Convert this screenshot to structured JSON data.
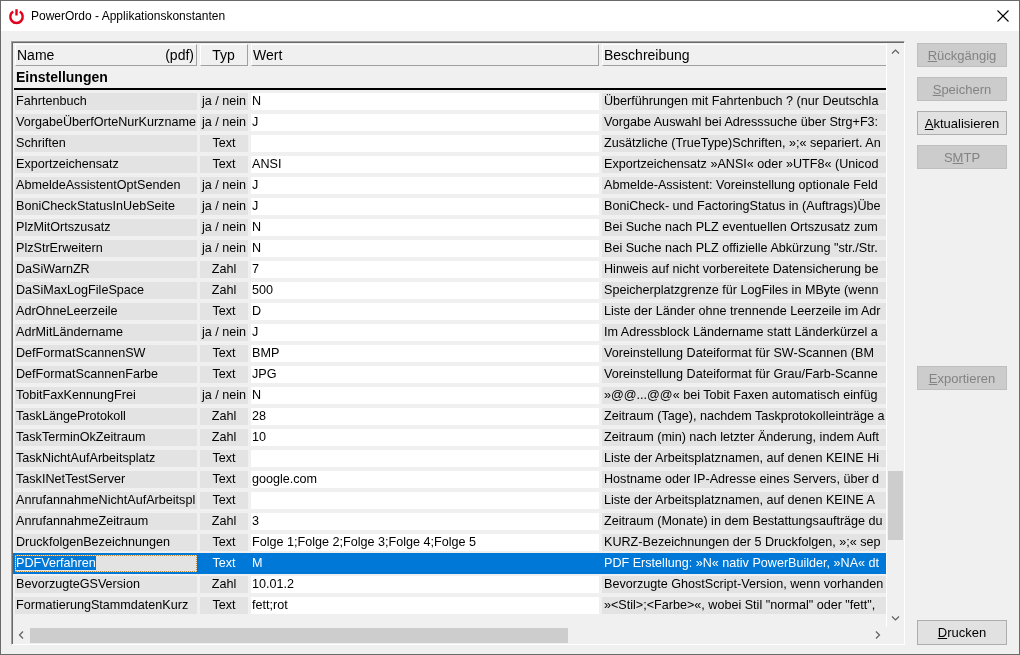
{
  "window": {
    "title": "PowerOrdo - Applikationskonstanten"
  },
  "table": {
    "columns": [
      {
        "label": "Name",
        "note": "(pdf)"
      },
      {
        "label": "Typ"
      },
      {
        "label": "Wert"
      },
      {
        "label": "Beschreibung"
      }
    ],
    "group": "Einstellungen",
    "rows": [
      {
        "name": "Fahrtenbuch",
        "type": "ja / nein",
        "value": "N",
        "description": "Überführungen mit Fahrtenbuch ? (nur Deutschla",
        "selected": false
      },
      {
        "name": "VorgabeÜberfOrteNurKurzname",
        "type": "ja / nein",
        "value": "J",
        "description": "Vorgabe Auswahl bei Adresssuche über Strg+F3:",
        "selected": false
      },
      {
        "name": "Schriften",
        "type": "Text",
        "description": "Zusätzliche (TrueType)Schriften, »;« separiert. An",
        "selected": false
      },
      {
        "name": "Exportzeichensatz",
        "type": "Text",
        "value": "ANSI",
        "description": "Exportzeichensatz »ANSI« oder »UTF8« (Unicod",
        "selected": false
      },
      {
        "name": "AbmeldeAssistentOptSenden",
        "type": "ja / nein",
        "value": "J",
        "description": "Abmelde-Assistent: Voreinstellung optionale Feld",
        "selected": false
      },
      {
        "name": "BoniCheckStatusInUebSeite",
        "type": "ja / nein",
        "value": "J",
        "description": "BoniCheck- und FactoringStatus in (Auftrags)Übe",
        "selected": false
      },
      {
        "name": "PlzMitOrtszusatz",
        "type": "ja / nein",
        "value": "N",
        "description": "Bei Suche nach PLZ eventuellen Ortszusatz zum",
        "selected": false
      },
      {
        "name": "PlzStrErweitern",
        "type": "ja / nein",
        "value": "N",
        "description": "Bei Suche nach PLZ offizielle Abkürzung \"str./Str.",
        "selected": false
      },
      {
        "name": "DaSiWarnZR",
        "type": "Zahl",
        "value": "7",
        "description": "Hinweis auf nicht vorbereitete Datensicherung be",
        "selected": false
      },
      {
        "name": "DaSiMaxLogFileSpace",
        "type": "Zahl",
        "value": "500",
        "description": "Speicherplatzgrenze für LogFiles in MByte (wenn",
        "selected": false
      },
      {
        "name": "AdrOhneLeerzeile",
        "type": "Text",
        "value": "D",
        "description": "Liste der Länder ohne trennende Leerzeile im Adr",
        "selected": false
      },
      {
        "name": "AdrMitLändername",
        "type": "ja / nein",
        "value": "J",
        "description": "Im Adressblock Ländername statt Länderkürzel a",
        "selected": false
      },
      {
        "name": "DefFormatScannenSW",
        "type": "Text",
        "value": "BMP",
        "description": "Voreinstellung Dateiformat für SW-Scannen (BM",
        "selected": false
      },
      {
        "name": "DefFormatScannenFarbe",
        "type": "Text",
        "value": "JPG",
        "description": "Voreinstellung Dateiformat für Grau/Farb-Scanne",
        "selected": false
      },
      {
        "name": "TobitFaxKennungFrei",
        "type": "ja / nein",
        "value": "N",
        "description": "»@@...@@« bei Tobit Faxen automatisch einfüg",
        "selected": false
      },
      {
        "name": "TaskLängeProtokoll",
        "type": "Zahl",
        "value": "28",
        "description": "Zeitraum (Tage), nachdem Taskprotokolleinträge a",
        "selected": false
      },
      {
        "name": "TaskTerminOkZeitraum",
        "type": "Zahl",
        "value": "10",
        "description": "Zeitraum (min) nach letzter Änderung, indem Auft",
        "selected": false
      },
      {
        "name": "TaskNichtAufArbeitsplatz",
        "type": "Text",
        "description": "Liste der Arbeitsplatznamen, auf denen KEINE Hi",
        "selected": false
      },
      {
        "name": "TaskINetTestServer",
        "type": "Text",
        "value": "google.com",
        "description": "Hostname oder IP-Adresse eines Servers, über d",
        "selected": false
      },
      {
        "name": "AnrufannahmeNichtAufArbeitspl",
        "type": "Text",
        "description": "Liste der Arbeitsplatznamen, auf denen KEINE A",
        "selected": false
      },
      {
        "name": "AnrufannahmeZeitraum",
        "type": "Zahl",
        "value": "3",
        "description": "Zeitraum (Monate) in dem Bestattungsaufträge du",
        "selected": false
      },
      {
        "name": "DruckfolgenBezeichnungen",
        "type": "Text",
        "value": "Folge 1;Folge 2;Folge 3;Folge 4;Folge 5",
        "description": "KURZ-Bezeichnungen der 5 Druckfolgen, »;« sep",
        "selected": false
      },
      {
        "name": "PDFVerfahren",
        "type": "Text",
        "value": "M",
        "description": "PDF Erstellung: »N« nativ PowerBuilder, »NA« dt",
        "selected": true
      },
      {
        "name": "BevorzugteGSVersion",
        "type": "Zahl",
        "value": "10.01.2",
        "description": "Bevorzugte GhostScript-Version, wenn vorhanden",
        "selected": false
      },
      {
        "name": "FormatierungStammdatenKurz",
        "type": "Text",
        "value": "fett;rot",
        "description": "»<Stil>;<Farbe>«, wobei Stil \"normal\" oder \"fett\",",
        "selected": false
      }
    ]
  },
  "button_groups": [
    {
      "buttons": [
        {
          "label_parts": [
            {
              "text": "R",
              "underlined": true
            },
            {
              "text": "ückgängig",
              "underlined": false
            }
          ],
          "disabled": true
        },
        {
          "label_parts": [
            {
              "text": "S",
              "underlined": true
            },
            {
              "text": "peichern",
              "underlined": false
            }
          ],
          "disabled": true
        },
        {
          "label_parts": [
            {
              "text": "A",
              "underlined": true
            },
            {
              "text": "ktualisieren",
              "underlined": false
            }
          ],
          "disabled": false
        },
        {
          "label_parts": [
            {
              "text": "S",
              "underlined": false
            },
            {
              "text": "M",
              "underlined": true
            },
            {
              "text": "TP",
              "underlined": false
            }
          ],
          "disabled": true
        }
      ]
    },
    {
      "buttons": [
        {
          "label_parts": [
            {
              "text": "E",
              "underlined": true
            },
            {
              "text": "xportieren",
              "underlined": false
            }
          ],
          "disabled": true
        }
      ]
    },
    {
      "buttons": [
        {
          "label_parts": [
            {
              "text": "D",
              "underlined": true
            },
            {
              "text": "rucken",
              "underlined": false
            }
          ],
          "disabled": false
        }
      ]
    }
  ]
}
